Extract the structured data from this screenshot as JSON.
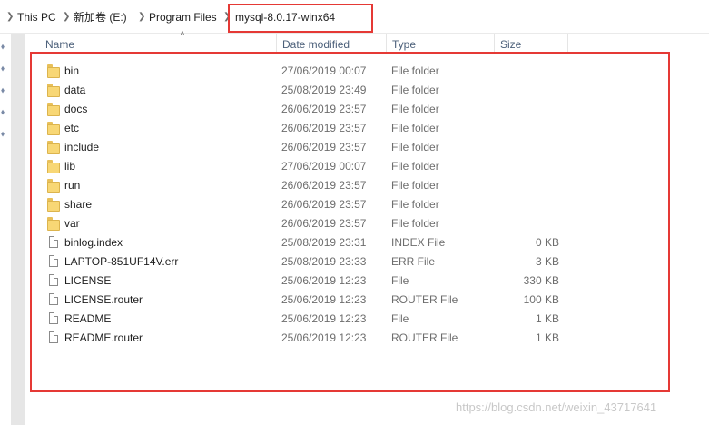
{
  "breadcrumb": {
    "items": [
      "This PC",
      "新加卷 (E:)",
      "Program Files",
      "mysql-8.0.17-winx64"
    ]
  },
  "columns": {
    "name": "Name",
    "date": "Date modified",
    "type": "Type",
    "size": "Size"
  },
  "files": [
    {
      "name": "bin",
      "date": "27/06/2019 00:07",
      "type": "File folder",
      "size": "",
      "icon": "folder-icon"
    },
    {
      "name": "data",
      "date": "25/08/2019 23:49",
      "type": "File folder",
      "size": "",
      "icon": "folder-icon"
    },
    {
      "name": "docs",
      "date": "26/06/2019 23:57",
      "type": "File folder",
      "size": "",
      "icon": "folder-icon"
    },
    {
      "name": "etc",
      "date": "26/06/2019 23:57",
      "type": "File folder",
      "size": "",
      "icon": "folder-icon"
    },
    {
      "name": "include",
      "date": "26/06/2019 23:57",
      "type": "File folder",
      "size": "",
      "icon": "folder-icon"
    },
    {
      "name": "lib",
      "date": "27/06/2019 00:07",
      "type": "File folder",
      "size": "",
      "icon": "folder-icon"
    },
    {
      "name": "run",
      "date": "26/06/2019 23:57",
      "type": "File folder",
      "size": "",
      "icon": "folder-icon"
    },
    {
      "name": "share",
      "date": "26/06/2019 23:57",
      "type": "File folder",
      "size": "",
      "icon": "folder-icon"
    },
    {
      "name": "var",
      "date": "26/06/2019 23:57",
      "type": "File folder",
      "size": "",
      "icon": "folder-icon"
    },
    {
      "name": "binlog.index",
      "date": "25/08/2019 23:31",
      "type": "INDEX File",
      "size": "0 KB",
      "icon": "file-icon"
    },
    {
      "name": "LAPTOP-851UF14V.err",
      "date": "25/08/2019 23:33",
      "type": "ERR File",
      "size": "3 KB",
      "icon": "file-icon"
    },
    {
      "name": "LICENSE",
      "date": "25/06/2019 12:23",
      "type": "File",
      "size": "330 KB",
      "icon": "file-icon"
    },
    {
      "name": "LICENSE.router",
      "date": "25/06/2019 12:23",
      "type": "ROUTER File",
      "size": "100 KB",
      "icon": "file-icon"
    },
    {
      "name": "README",
      "date": "25/06/2019 12:23",
      "type": "File",
      "size": "1 KB",
      "icon": "file-icon"
    },
    {
      "name": "README.router",
      "date": "25/06/2019 12:23",
      "type": "ROUTER File",
      "size": "1 KB",
      "icon": "file-icon"
    }
  ],
  "watermark": "https://blog.csdn.net/weixin_43717641",
  "colors": {
    "annotation": "#e53935",
    "folder": "#f8d775",
    "header_text": "#4c607a"
  }
}
